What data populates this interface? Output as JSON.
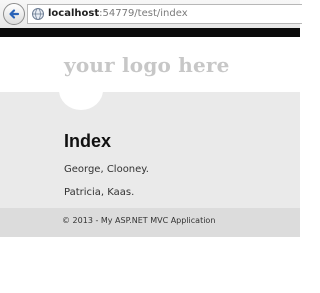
{
  "browser": {
    "url_host": "localhost",
    "url_path": ":54779/test/index"
  },
  "header": {
    "logo_text": "your logo here"
  },
  "main": {
    "title": "Index",
    "items": [
      "George, Clooney.",
      "Patricia, Kaas."
    ]
  },
  "footer": {
    "text": "© 2013 - My ASP.NET MVC Application"
  },
  "icons": [
    "back-arrow-icon",
    "globe-icon"
  ],
  "colors": {
    "header_bg": "#ffffff",
    "strip": "#0a0a0a",
    "main_bg": "#eaeaea",
    "footer_bg": "#dcdcdc",
    "logo": "#c7c7c7"
  }
}
